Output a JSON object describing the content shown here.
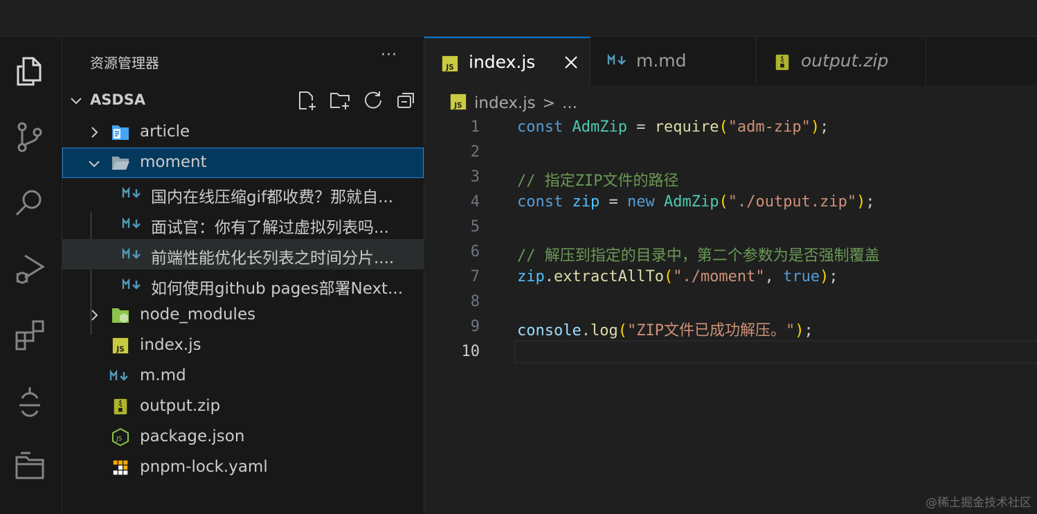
{
  "explorer": {
    "title": "资源管理器",
    "more": "···",
    "root": "ASDSA",
    "items": [
      {
        "label": "article"
      },
      {
        "label": "moment"
      },
      {
        "label": "国内在线压缩gif都收费？那就自..."
      },
      {
        "label": "面试官：你有了解过虚拟列表吗..."
      },
      {
        "label": "前端性能优化长列表之时间分片...."
      },
      {
        "label": "如何使用github pages部署Next..."
      },
      {
        "label": "node_modules"
      },
      {
        "label": "index.js"
      },
      {
        "label": "m.md"
      },
      {
        "label": "output.zip"
      },
      {
        "label": "package.json"
      },
      {
        "label": "pnpm-lock.yaml"
      }
    ]
  },
  "tabs": [
    {
      "label": "index.js"
    },
    {
      "label": "m.md"
    },
    {
      "label": "output.zip"
    }
  ],
  "breadcrumb": {
    "file": "index.js",
    "sep": ">",
    "rest": "..."
  },
  "code": {
    "lines": [
      "1",
      "2",
      "3",
      "4",
      "5",
      "6",
      "7",
      "8",
      "9",
      "10"
    ],
    "l1": {
      "kw": "const",
      "var": "AdmZip",
      "op": " = ",
      "fn": "require",
      "p1": "(",
      "str": "\"adm-zip\"",
      "p2": ")",
      "end": ";"
    },
    "l3": "// 指定ZIP文件的路径",
    "l4": {
      "kw": "const",
      "var": "zip",
      "op": " = ",
      "kw2": "new",
      "cls": "AdmZip",
      "p1": "(",
      "str": "\"./output.zip\"",
      "p2": ")",
      "end": ";"
    },
    "l6": "// 解压到指定的目录中，第二个参数为是否强制覆盖",
    "l7": {
      "obj": "zip",
      "dot": ".",
      "fn": "extractAllTo",
      "p1": "(",
      "str": "\"./moment\"",
      "comma": ", ",
      "bool": "true",
      "p2": ")",
      "end": ";"
    },
    "l9": {
      "obj": "console",
      "dot": ".",
      "fn": "log",
      "p1": "(",
      "str": "\"ZIP文件已成功解压。\"",
      "p2": ")",
      "end": ";"
    }
  },
  "watermark": "@稀土掘金技术社区",
  "colors": {
    "accent": "#0078d4",
    "selection": "#04395e",
    "js_yellow": "#cbcb41",
    "md_blue": "#519aba",
    "node_green": "#8bc34a"
  }
}
